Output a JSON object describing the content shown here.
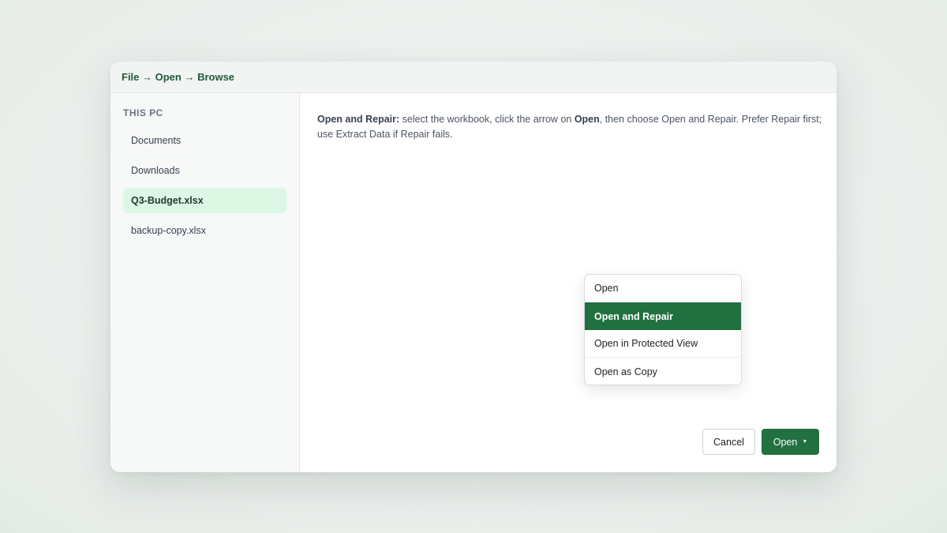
{
  "dialog": {
    "breadcrumb": "File → Open → Browse"
  },
  "sidebar": {
    "heading": "THIS PC",
    "items": [
      {
        "label": "Documents"
      },
      {
        "label": "Downloads"
      },
      {
        "label": "Q3-Budget.xlsx",
        "selected": true
      },
      {
        "label": "backup-copy.xlsx"
      }
    ]
  },
  "instruction": {
    "lead": "Open and Repair:",
    "part1": " select the workbook, click the arrow on ",
    "emph": "Open",
    "part2": ", then choose Open and Repair. Prefer Repair first; use Extract Data if Repair fails."
  },
  "open_menu": {
    "items": [
      {
        "label": "Open"
      },
      {
        "label": "Open and Repair",
        "highlighted": true
      },
      {
        "label": "Open in Protected View"
      },
      {
        "label": "Open as Copy"
      }
    ]
  },
  "buttons": {
    "cancel": "Cancel",
    "open": "Open",
    "open_caret": "▼"
  },
  "colors": {
    "accent": "#21703f",
    "selected_bg": "#dcf7e4",
    "breadcrumb": "#1e5a36"
  }
}
